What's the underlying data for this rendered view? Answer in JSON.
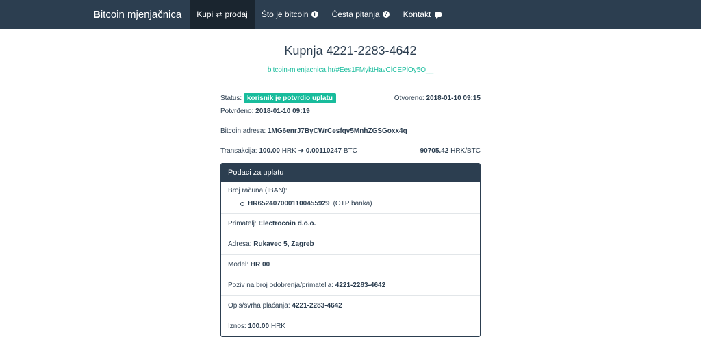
{
  "nav": {
    "brand_icon": "B",
    "brand_text": "itcoin mjenjačnica",
    "items": [
      {
        "label": "Kupi",
        "label2": "prodaj",
        "icon": "exchange-icon"
      },
      {
        "label": "Što je bitcoin",
        "icon": "info-circle-icon"
      },
      {
        "label": "Česta pitanja",
        "icon": "question-circle-icon"
      },
      {
        "label": "Kontakt",
        "icon": "comment-icon"
      }
    ]
  },
  "title": "Kupnja 4221-2283-4642",
  "link": "bitcoin-mjenjacnica.hr/#Ees1FMyktHavClCEPlOy5O__",
  "status": {
    "label": "Status:",
    "badge": "korisnik je potvrdio uplatu",
    "opened_label": "Otvoreno:",
    "opened_value": "2018-01-10 09:15",
    "confirmed_label": "Potvrđeno:",
    "confirmed_value": "2018-01-10 09:19",
    "address_label": "Bitcoin adresa:",
    "address_value": "1MG6enrJ7ByCWrCesfqv5MnhZGSGoxx4q",
    "tx_label": "Transakcija:",
    "tx_amount": "100.00",
    "tx_currency": "HRK",
    "tx_btc": "0.00110247",
    "tx_btc_unit": "BTC",
    "rate_value": "90705.42",
    "rate_unit": "HRK/BTC"
  },
  "panel": {
    "heading": "Podaci za uplatu",
    "iban_label": "Broj računa (IBAN):",
    "iban_value": "HR6524070001100455929",
    "iban_bank": "(OTP banka)",
    "recipient_label": "Primatelj:",
    "recipient_value": "Electrocoin d.o.o.",
    "address_label": "Adresa:",
    "address_value": "Rukavec 5, Zagreb",
    "model_label": "Model:",
    "model_value": "HR 00",
    "reference_label": "Poziv na broj odobrenja/primatelja:",
    "reference_value": "4221-2283-4642",
    "description_label": "Opis/svrha plaćanja:",
    "description_value": "4221-2283-4642",
    "amount_label": "Iznos:",
    "amount_value": "100.00",
    "amount_currency": "HRK"
  },
  "colors": {
    "navbar": "#2c3e50",
    "accent": "#18bc9c"
  }
}
